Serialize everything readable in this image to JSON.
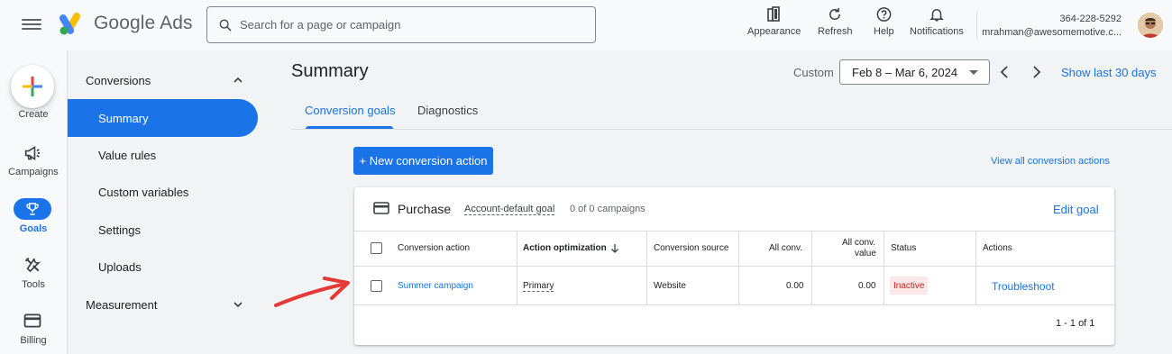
{
  "header": {
    "app_name": "Google Ads",
    "search_placeholder": "Search for a page or campaign",
    "tools": [
      {
        "label": "Appearance",
        "icon": "appearance-icon"
      },
      {
        "label": "Refresh",
        "icon": "refresh-icon"
      },
      {
        "label": "Help",
        "icon": "help-icon"
      },
      {
        "label": "Notifications",
        "icon": "bell-icon"
      }
    ],
    "account_id": "364-228-5292",
    "account_email": "mrahman@awesomemotive.c..."
  },
  "rail": {
    "items": [
      {
        "label": "Create",
        "icon": "plus-icon"
      },
      {
        "label": "Campaigns",
        "icon": "megaphone-icon"
      },
      {
        "label": "Goals",
        "icon": "trophy-icon"
      },
      {
        "label": "Tools",
        "icon": "tools-icon"
      },
      {
        "label": "Billing",
        "icon": "card-icon"
      }
    ]
  },
  "nav": {
    "section_conversions": "Conversions",
    "items": [
      "Summary",
      "Value rules",
      "Custom variables",
      "Settings",
      "Uploads"
    ],
    "section_measurement": "Measurement"
  },
  "main": {
    "title": "Summary",
    "date_label": "Custom",
    "date_range": "Feb 8 – Mar 6, 2024",
    "show_last": "Show last 30 days",
    "tabs": [
      "Conversion goals",
      "Diagnostics"
    ],
    "new_action_button": "+ New conversion action",
    "view_all_link": "View all conversion actions"
  },
  "goal_card": {
    "title": "Purchase",
    "badge": "Account-default goal",
    "campaign_count": "0 of 0 campaigns",
    "edit_link": "Edit goal",
    "columns": {
      "action": "Conversion action",
      "optimization": "Action optimization",
      "source": "Conversion source",
      "all_conv": "All conv.",
      "all_conv_value_1": "All conv.",
      "all_conv_value_2": "value",
      "status": "Status",
      "actions": "Actions"
    },
    "row": {
      "action": "Summer campaign",
      "optimization": "Primary",
      "source": "Website",
      "all_conv": "0.00",
      "all_conv_value": "0.00",
      "status": "Inactive",
      "actions": "Troubleshoot"
    },
    "pagination": "1 - 1 of 1"
  },
  "colors": {
    "accent": "#1a73e8",
    "status_inactive": "#c5221f",
    "annotation_arrow": "#e53935"
  }
}
